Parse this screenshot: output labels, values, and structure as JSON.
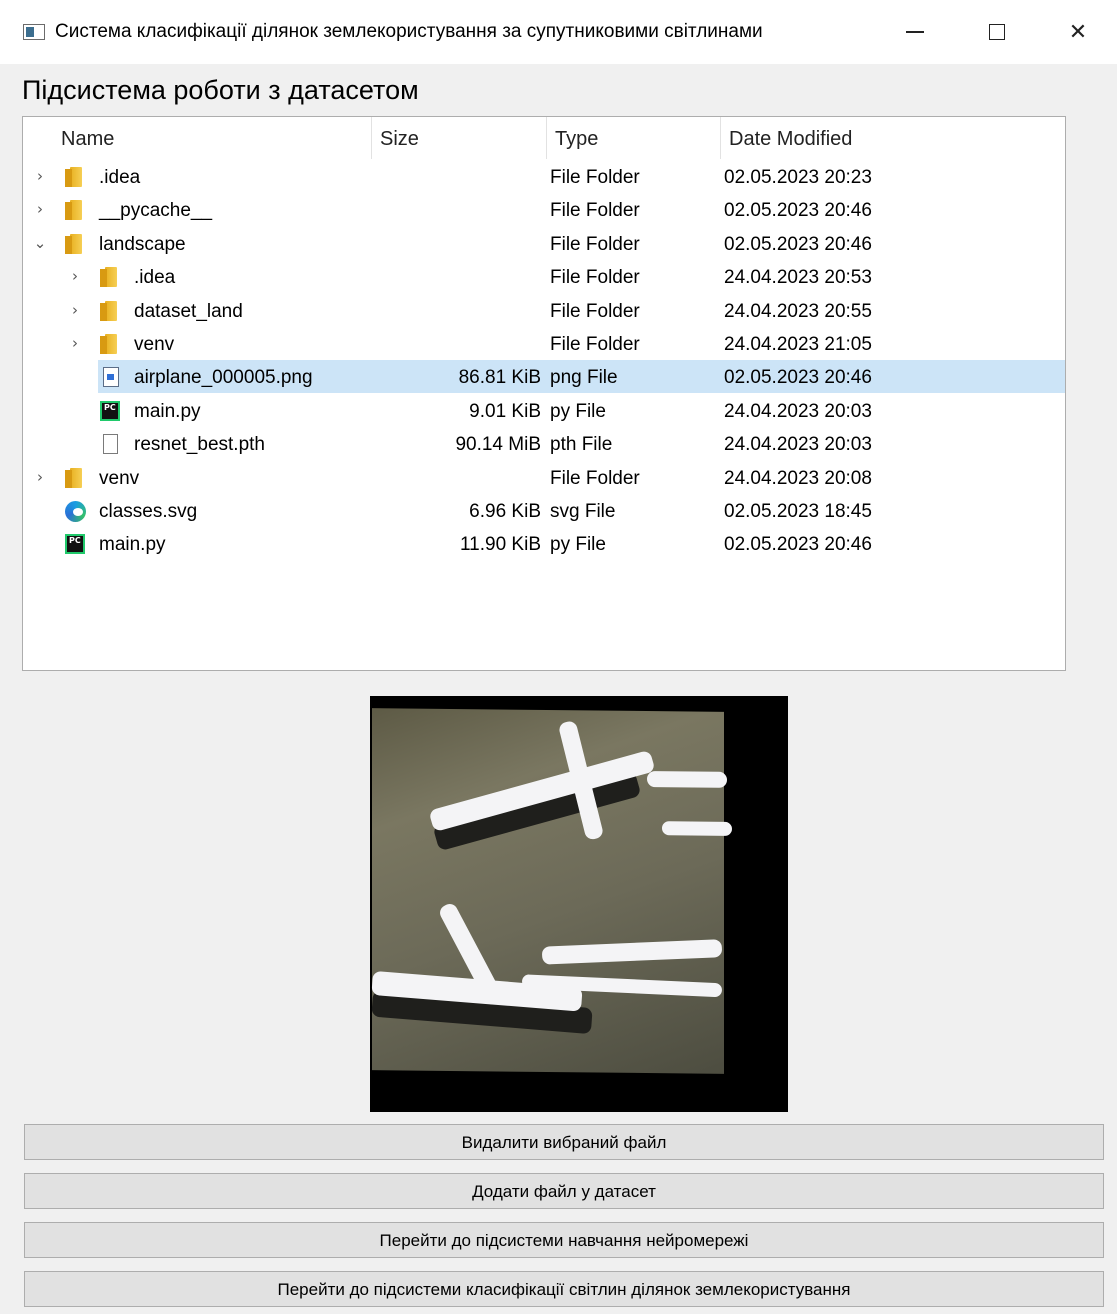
{
  "window": {
    "title": "Система класифікації ділянок землекористування за супутниковими світлинами",
    "controls": [
      "minimize-icon",
      "maximize-icon",
      "close-icon"
    ],
    "close_glyph": "✕"
  },
  "page_title": "Підсистема роботи з датасетом",
  "tree": {
    "columns": [
      "Name",
      "Size",
      "Type",
      "Date Modified"
    ],
    "rows": [
      {
        "level": 0,
        "expander": "›",
        "icon": "folder-icon",
        "name": ".idea",
        "size": "",
        "type": "File Folder",
        "date": "02.05.2023 20:23",
        "selected": false
      },
      {
        "level": 0,
        "expander": "›",
        "icon": "folder-icon",
        "name": "__pycache__",
        "size": "",
        "type": "File Folder",
        "date": "02.05.2023 20:46",
        "selected": false
      },
      {
        "level": 0,
        "expander": "⌄",
        "icon": "folder-icon",
        "name": "landscape",
        "size": "",
        "type": "File Folder",
        "date": "02.05.2023 20:46",
        "selected": false
      },
      {
        "level": 1,
        "expander": "›",
        "icon": "folder-icon",
        "name": ".idea",
        "size": "",
        "type": "File Folder",
        "date": "24.04.2023 20:53",
        "selected": false
      },
      {
        "level": 1,
        "expander": "›",
        "icon": "folder-icon",
        "name": "dataset_land",
        "size": "",
        "type": "File Folder",
        "date": "24.04.2023 20:55",
        "selected": false
      },
      {
        "level": 1,
        "expander": "›",
        "icon": "folder-icon",
        "name": "venv",
        "size": "",
        "type": "File Folder",
        "date": "24.04.2023 21:05",
        "selected": false
      },
      {
        "level": 1,
        "expander": "",
        "icon": "png-file-icon",
        "name": "airplane_000005.png",
        "size": "86.81 KiB",
        "type": "png File",
        "date": "02.05.2023 20:46",
        "selected": true
      },
      {
        "level": 1,
        "expander": "",
        "icon": "pycharm-file-icon",
        "name": "main.py",
        "size": "9.01 KiB",
        "type": "py File",
        "date": "24.04.2023 20:03",
        "selected": false
      },
      {
        "level": 1,
        "expander": "",
        "icon": "blank-file-icon",
        "name": "resnet_best.pth",
        "size": "90.14 MiB",
        "type": "pth File",
        "date": "24.04.2023 20:03",
        "selected": false
      },
      {
        "level": 0,
        "expander": "›",
        "icon": "folder-icon",
        "name": "venv",
        "size": "",
        "type": "File Folder",
        "date": "24.04.2023 20:08",
        "selected": false
      },
      {
        "level": 0,
        "expander": "",
        "icon": "edge-svg-icon",
        "name": "classes.svg",
        "size": "6.96 KiB",
        "type": "svg File",
        "date": "02.05.2023 18:45",
        "selected": false
      },
      {
        "level": 0,
        "expander": "",
        "icon": "pycharm-file-icon",
        "name": "main.py",
        "size": "11.90 KiB",
        "type": "py File",
        "date": "02.05.2023 20:46",
        "selected": false
      }
    ]
  },
  "preview": {
    "content": "airplane-satellite-image"
  },
  "buttons": {
    "delete": "Видалити вибраний файл",
    "add": "Додати файл у датасет",
    "training": "Перейти до підсистеми навчання нейромережі",
    "classification": "Перейти до підсистеми класифікації світлин ділянок землекористування"
  },
  "colors": {
    "selection": "#cce4f7",
    "window_bg": "#f0f0f0",
    "button_bg": "#e1e1e1"
  }
}
